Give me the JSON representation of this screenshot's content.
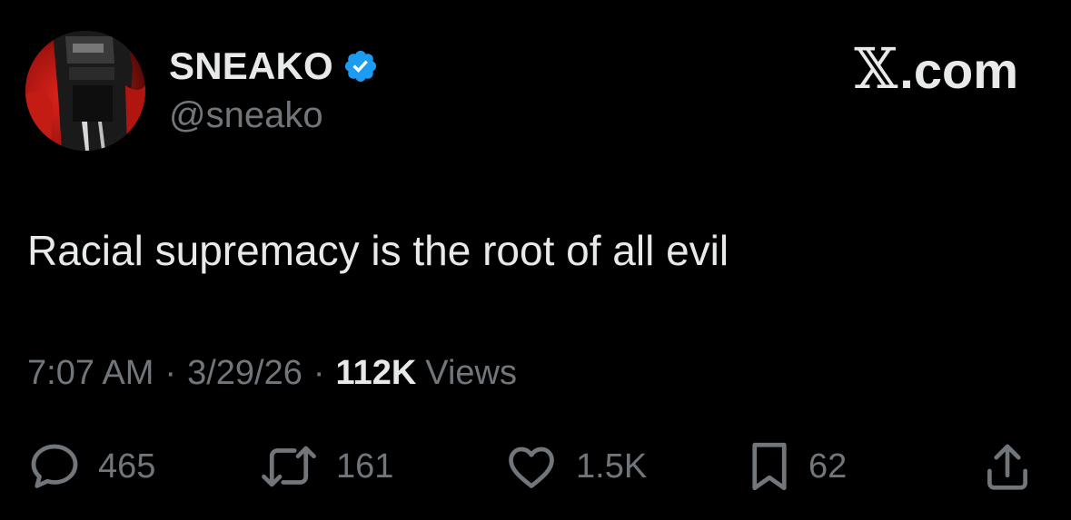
{
  "author": {
    "display_name": "SNEAKO",
    "handle": "@sneako",
    "verified_icon": "verified-badge-icon"
  },
  "brand": {
    "label": ".com",
    "glyph": "𝕏"
  },
  "tweet": {
    "text": "Racial supremacy is the root of all evil"
  },
  "meta": {
    "time": "7:07 AM",
    "separator": "·",
    "date": "3/29/26",
    "views_count": "112K",
    "views_label": "Views"
  },
  "actions": {
    "replies": "465",
    "retweets": "161",
    "likes": "1.5K",
    "bookmarks": "62"
  },
  "colors": {
    "background": "#000000",
    "text_primary": "#e7e9ea",
    "text_secondary": "#71767b",
    "verified_blue": "#1d9bf0"
  }
}
